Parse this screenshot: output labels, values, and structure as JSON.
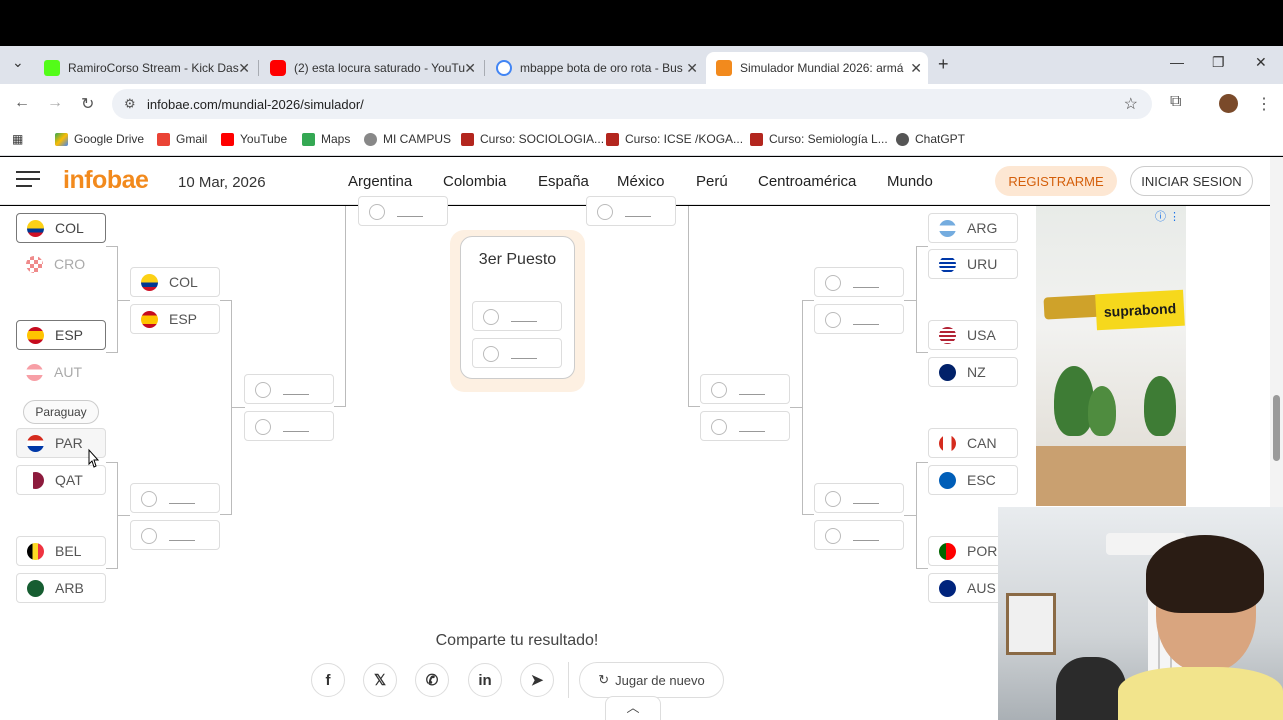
{
  "browser": {
    "tabs": [
      {
        "title": "RamiroCorso Stream - Kick Das",
        "icon_color": "#53fc18"
      },
      {
        "title": "(2) esta locura saturado - YouTu",
        "icon_color": "#ff0000"
      },
      {
        "title": "mbappe bota de oro rota - Bus",
        "icon_color": "#4285f4"
      },
      {
        "title": "Simulador Mundial 2026: armá",
        "icon_color": "#f28a1d"
      }
    ],
    "new_tab": "+",
    "url": "infobae.com/mundial-2026/simulador/",
    "bookmarks": [
      "Google Drive",
      "Gmail",
      "YouTube",
      "Maps",
      "MI CAMPUS",
      "Curso: SOCIOLOGIA...",
      "Curso: ICSE /KOGA...",
      "Curso: Semiología L...",
      "ChatGPT"
    ]
  },
  "site": {
    "logo": "infobae",
    "date": "10 Mar, 2026",
    "nav": [
      "Argentina",
      "Colombia",
      "España",
      "México",
      "Perú",
      "Centroamérica",
      "Mundo"
    ],
    "register": "REGISTRARME",
    "login": "INICIAR SESION"
  },
  "bracket": {
    "left_r1": [
      "COL",
      "CRO",
      "ESP",
      "AUT",
      "PAR",
      "QAT",
      "BEL",
      "ARB"
    ],
    "left_r2": [
      "COL",
      "ESP"
    ],
    "right_r1": [
      "ARG",
      "URU",
      "USA",
      "NZ",
      "CAN",
      "ESC",
      "POR",
      "AUS"
    ],
    "third_place_title": "3er Puesto",
    "tooltip": "Paraguay",
    "empty_slot": "___"
  },
  "share": {
    "title": "Comparte tu resultado!",
    "replay": "Jugar de nuevo"
  },
  "ad": {
    "brand": "suprabond"
  }
}
